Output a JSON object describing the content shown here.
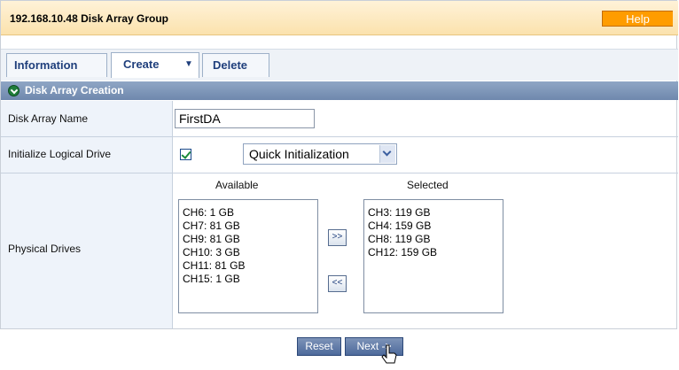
{
  "header": {
    "title": "192.168.10.48 Disk Array Group",
    "help_label": "Help"
  },
  "tabs": [
    {
      "label": "Information"
    },
    {
      "label": "Create"
    },
    {
      "label": "Delete"
    }
  ],
  "section": {
    "title": "Disk Array Creation"
  },
  "form": {
    "name_label": "Disk Array Name",
    "name_value": "FirstDA",
    "init_label": "Initialize Logical Drive",
    "init_checked": true,
    "init_option": "Quick Initialization",
    "drives_label": "Physical Drives",
    "available_label": "Available",
    "selected_label": "Selected",
    "available": [
      "CH6: 1 GB",
      "CH7: 81 GB",
      "CH9: 81 GB",
      "CH10: 3 GB",
      "CH11: 81 GB",
      "CH15: 1 GB"
    ],
    "selected": [
      "CH3: 119 GB",
      "CH4: 159 GB",
      "CH8: 119 GB",
      "CH12: 159 GB"
    ],
    "add_label": ">>",
    "remove_label": "<<"
  },
  "footer": {
    "reset_label": "Reset",
    "next_label": "Next ->"
  },
  "colors": {
    "accent": "#ff9c00",
    "title_bg": "#fbe2ad",
    "section_bg": "#7d95b8",
    "tab_text": "#1f3f7c"
  },
  "icons": {
    "section": "chevron-down-circle-icon",
    "tab_caret": "caret-down-icon"
  }
}
